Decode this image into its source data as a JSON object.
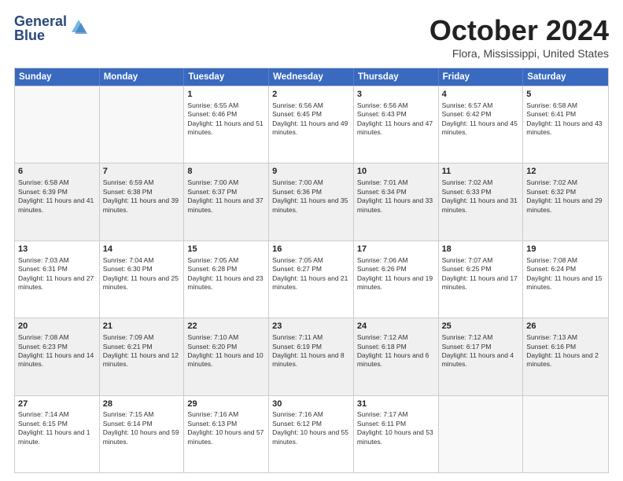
{
  "header": {
    "logo_line1": "General",
    "logo_line2": "Blue",
    "month_title": "October 2024",
    "location": "Flora, Mississippi, United States"
  },
  "days_of_week": [
    "Sunday",
    "Monday",
    "Tuesday",
    "Wednesday",
    "Thursday",
    "Friday",
    "Saturday"
  ],
  "weeks": [
    [
      {
        "day": "",
        "text": "",
        "empty": true
      },
      {
        "day": "",
        "text": "",
        "empty": true
      },
      {
        "day": "1",
        "text": "Sunrise: 6:55 AM\nSunset: 6:46 PM\nDaylight: 11 hours and 51 minutes."
      },
      {
        "day": "2",
        "text": "Sunrise: 6:56 AM\nSunset: 6:45 PM\nDaylight: 11 hours and 49 minutes."
      },
      {
        "day": "3",
        "text": "Sunrise: 6:56 AM\nSunset: 6:43 PM\nDaylight: 11 hours and 47 minutes."
      },
      {
        "day": "4",
        "text": "Sunrise: 6:57 AM\nSunset: 6:42 PM\nDaylight: 11 hours and 45 minutes."
      },
      {
        "day": "5",
        "text": "Sunrise: 6:58 AM\nSunset: 6:41 PM\nDaylight: 11 hours and 43 minutes."
      }
    ],
    [
      {
        "day": "6",
        "text": "Sunrise: 6:58 AM\nSunset: 6:39 PM\nDaylight: 11 hours and 41 minutes."
      },
      {
        "day": "7",
        "text": "Sunrise: 6:59 AM\nSunset: 6:38 PM\nDaylight: 11 hours and 39 minutes."
      },
      {
        "day": "8",
        "text": "Sunrise: 7:00 AM\nSunset: 6:37 PM\nDaylight: 11 hours and 37 minutes."
      },
      {
        "day": "9",
        "text": "Sunrise: 7:00 AM\nSunset: 6:36 PM\nDaylight: 11 hours and 35 minutes."
      },
      {
        "day": "10",
        "text": "Sunrise: 7:01 AM\nSunset: 6:34 PM\nDaylight: 11 hours and 33 minutes."
      },
      {
        "day": "11",
        "text": "Sunrise: 7:02 AM\nSunset: 6:33 PM\nDaylight: 11 hours and 31 minutes."
      },
      {
        "day": "12",
        "text": "Sunrise: 7:02 AM\nSunset: 6:32 PM\nDaylight: 11 hours and 29 minutes."
      }
    ],
    [
      {
        "day": "13",
        "text": "Sunrise: 7:03 AM\nSunset: 6:31 PM\nDaylight: 11 hours and 27 minutes."
      },
      {
        "day": "14",
        "text": "Sunrise: 7:04 AM\nSunset: 6:30 PM\nDaylight: 11 hours and 25 minutes."
      },
      {
        "day": "15",
        "text": "Sunrise: 7:05 AM\nSunset: 6:28 PM\nDaylight: 11 hours and 23 minutes."
      },
      {
        "day": "16",
        "text": "Sunrise: 7:05 AM\nSunset: 6:27 PM\nDaylight: 11 hours and 21 minutes."
      },
      {
        "day": "17",
        "text": "Sunrise: 7:06 AM\nSunset: 6:26 PM\nDaylight: 11 hours and 19 minutes."
      },
      {
        "day": "18",
        "text": "Sunrise: 7:07 AM\nSunset: 6:25 PM\nDaylight: 11 hours and 17 minutes."
      },
      {
        "day": "19",
        "text": "Sunrise: 7:08 AM\nSunset: 6:24 PM\nDaylight: 11 hours and 15 minutes."
      }
    ],
    [
      {
        "day": "20",
        "text": "Sunrise: 7:08 AM\nSunset: 6:23 PM\nDaylight: 11 hours and 14 minutes."
      },
      {
        "day": "21",
        "text": "Sunrise: 7:09 AM\nSunset: 6:21 PM\nDaylight: 11 hours and 12 minutes."
      },
      {
        "day": "22",
        "text": "Sunrise: 7:10 AM\nSunset: 6:20 PM\nDaylight: 11 hours and 10 minutes."
      },
      {
        "day": "23",
        "text": "Sunrise: 7:11 AM\nSunset: 6:19 PM\nDaylight: 11 hours and 8 minutes."
      },
      {
        "day": "24",
        "text": "Sunrise: 7:12 AM\nSunset: 6:18 PM\nDaylight: 11 hours and 6 minutes."
      },
      {
        "day": "25",
        "text": "Sunrise: 7:12 AM\nSunset: 6:17 PM\nDaylight: 11 hours and 4 minutes."
      },
      {
        "day": "26",
        "text": "Sunrise: 7:13 AM\nSunset: 6:16 PM\nDaylight: 11 hours and 2 minutes."
      }
    ],
    [
      {
        "day": "27",
        "text": "Sunrise: 7:14 AM\nSunset: 6:15 PM\nDaylight: 11 hours and 1 minute."
      },
      {
        "day": "28",
        "text": "Sunrise: 7:15 AM\nSunset: 6:14 PM\nDaylight: 10 hours and 59 minutes."
      },
      {
        "day": "29",
        "text": "Sunrise: 7:16 AM\nSunset: 6:13 PM\nDaylight: 10 hours and 57 minutes."
      },
      {
        "day": "30",
        "text": "Sunrise: 7:16 AM\nSunset: 6:12 PM\nDaylight: 10 hours and 55 minutes."
      },
      {
        "day": "31",
        "text": "Sunrise: 7:17 AM\nSunset: 6:11 PM\nDaylight: 10 hours and 53 minutes."
      },
      {
        "day": "",
        "text": "",
        "empty": true
      },
      {
        "day": "",
        "text": "",
        "empty": true
      }
    ]
  ]
}
